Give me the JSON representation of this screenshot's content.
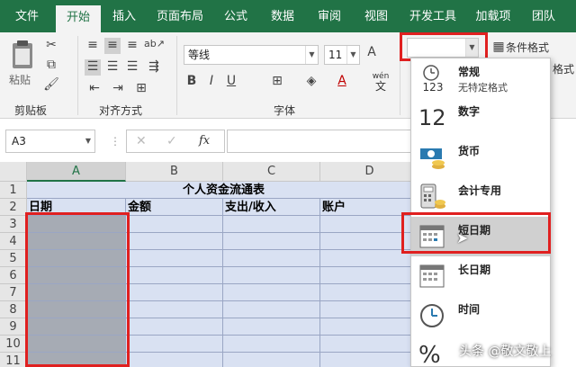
{
  "tabs": [
    "文件",
    "开始",
    "插入",
    "页面布局",
    "公式",
    "数据",
    "审阅",
    "视图",
    "开发工具",
    "加载项",
    "团队"
  ],
  "active_tab": "开始",
  "ribbon": {
    "paste_label": "粘贴",
    "group_clipboard": "剪贴板",
    "group_alignment": "对齐方式",
    "group_font": "字体",
    "font_name": "等线",
    "font_size": "11",
    "number_format_value": "",
    "conditional_format": "条件格式",
    "format_partial": "格式",
    "phonetic_top": "wén",
    "phonetic_bottom": "文"
  },
  "formula_bar": {
    "name_box": "A3",
    "cancel": "✕",
    "confirm": "✓",
    "fx": "fx"
  },
  "grid": {
    "columns": [
      "A",
      "B",
      "C",
      "D"
    ],
    "rows": [
      "1",
      "2",
      "3",
      "4",
      "5",
      "6",
      "7",
      "8",
      "9",
      "10",
      "11"
    ],
    "title": "个人资金流通表",
    "headers": [
      "日期",
      "金额",
      "支出/收入",
      "账户"
    ]
  },
  "format_dropdown": {
    "items": [
      {
        "label": "常规",
        "sub": "无特定格式",
        "icon": "general-123-icon",
        "icon_text": "123"
      },
      {
        "label": "数字",
        "sub": "",
        "icon": "number-12-icon",
        "icon_text": "12"
      },
      {
        "label": "货币",
        "sub": "",
        "icon": "currency-icon"
      },
      {
        "label": "会计专用",
        "sub": "",
        "icon": "accounting-icon"
      },
      {
        "label": "短日期",
        "sub": "",
        "icon": "calendar-icon"
      },
      {
        "label": "长日期",
        "sub": "",
        "icon": "calendar-icon"
      },
      {
        "label": "时间",
        "sub": "",
        "icon": "clock-icon"
      },
      {
        "label": "",
        "sub": "",
        "icon": "percent-icon",
        "icon_text": "%"
      }
    ],
    "highlighted_index": 4
  },
  "watermark": "头条 @敬文敬上",
  "colors": {
    "accent": "#217346",
    "highlight_red": "#e02020",
    "table_fill": "#d9e1f2",
    "selected_fill": "#a6abb4"
  }
}
